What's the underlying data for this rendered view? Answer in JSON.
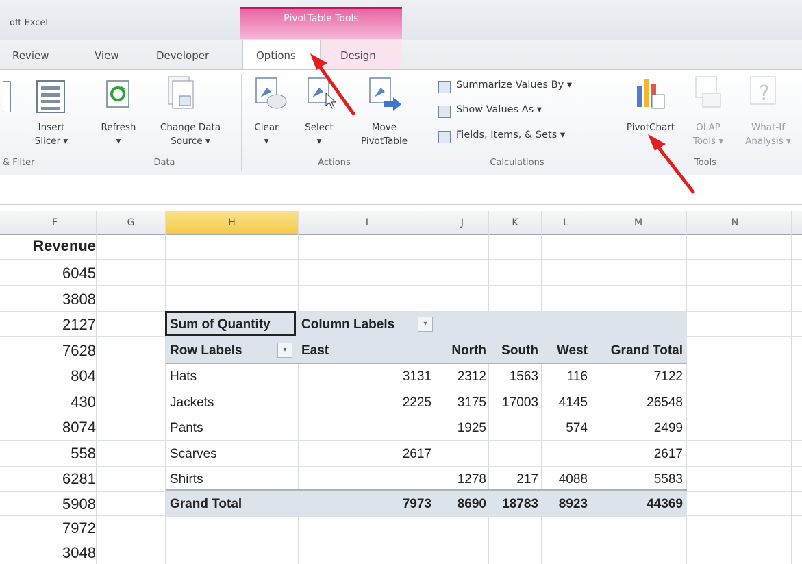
{
  "app": {
    "title": "oft Excel",
    "context_tab_title": "PivotTable Tools"
  },
  "tabs": [
    {
      "label": "Review"
    },
    {
      "label": "View"
    },
    {
      "label": "Developer"
    },
    {
      "label": "Options"
    },
    {
      "label": "Design"
    }
  ],
  "ribbon": {
    "groups": {
      "filter": "& Filter",
      "data": "Data",
      "actions": "Actions",
      "calculations": "Calculations",
      "tools": "Tools"
    },
    "insert_slicer": {
      "line1": "Insert",
      "line2": "Slicer ▾"
    },
    "refresh": {
      "line1": "Refresh",
      "line2": "▾"
    },
    "change_data_source": {
      "line1": "Change Data",
      "line2": "Source ▾"
    },
    "clear": {
      "line1": "Clear",
      "line2": "▾"
    },
    "select": {
      "line1": "Select",
      "line2": "▾"
    },
    "move_pivot": {
      "line1": "Move",
      "line2": "PivotTable"
    },
    "summarize": "Summarize Values By ▾",
    "show_values": "Show Values As ▾",
    "fields_items": "Fields, Items, & Sets ▾",
    "pivotchart": "PivotChart",
    "olap": {
      "line1": "OLAP",
      "line2": "Tools ▾"
    },
    "whatif": {
      "line1": "What-If",
      "line2": "Analysis ▾"
    }
  },
  "columns": [
    "F",
    "G",
    "H",
    "I",
    "J",
    "K",
    "L",
    "M",
    "N"
  ],
  "revenue": {
    "header": "Revenue",
    "values": [
      "6045",
      "3808",
      "2127",
      "7628",
      "804",
      "430",
      "8074",
      "558",
      "6281",
      "5908",
      "7972",
      "3048"
    ]
  },
  "pivot": {
    "corner": "Sum of Quantity",
    "column_labels": "Column Labels",
    "row_labels": "Row Labels",
    "headers": [
      "East",
      "North",
      "South",
      "West",
      "Grand Total"
    ],
    "rows": [
      {
        "label": "Hats",
        "east": "3131",
        "north": "2312",
        "south": "1563",
        "west": "116",
        "total": "7122"
      },
      {
        "label": "Jackets",
        "east": "2225",
        "north": "3175",
        "south": "17003",
        "west": "4145",
        "total": "26548"
      },
      {
        "label": "Pants",
        "east": "",
        "north": "1925",
        "south": "",
        "west": "574",
        "total": "2499"
      },
      {
        "label": "Scarves",
        "east": "2617",
        "north": "",
        "south": "",
        "west": "",
        "total": "2617"
      },
      {
        "label": "Shirts",
        "east": "",
        "north": "1278",
        "south": "217",
        "west": "4088",
        "total": "5583"
      }
    ],
    "grand_total": {
      "label": "Grand Total",
      "east": "7973",
      "north": "8690",
      "south": "18783",
      "west": "8923",
      "total": "44369"
    }
  },
  "colors": {
    "context_pink": "#e866a6",
    "arrow_red": "#e02020",
    "selected_col": "#f3c94a",
    "pivot_band": "#dde3ea"
  }
}
